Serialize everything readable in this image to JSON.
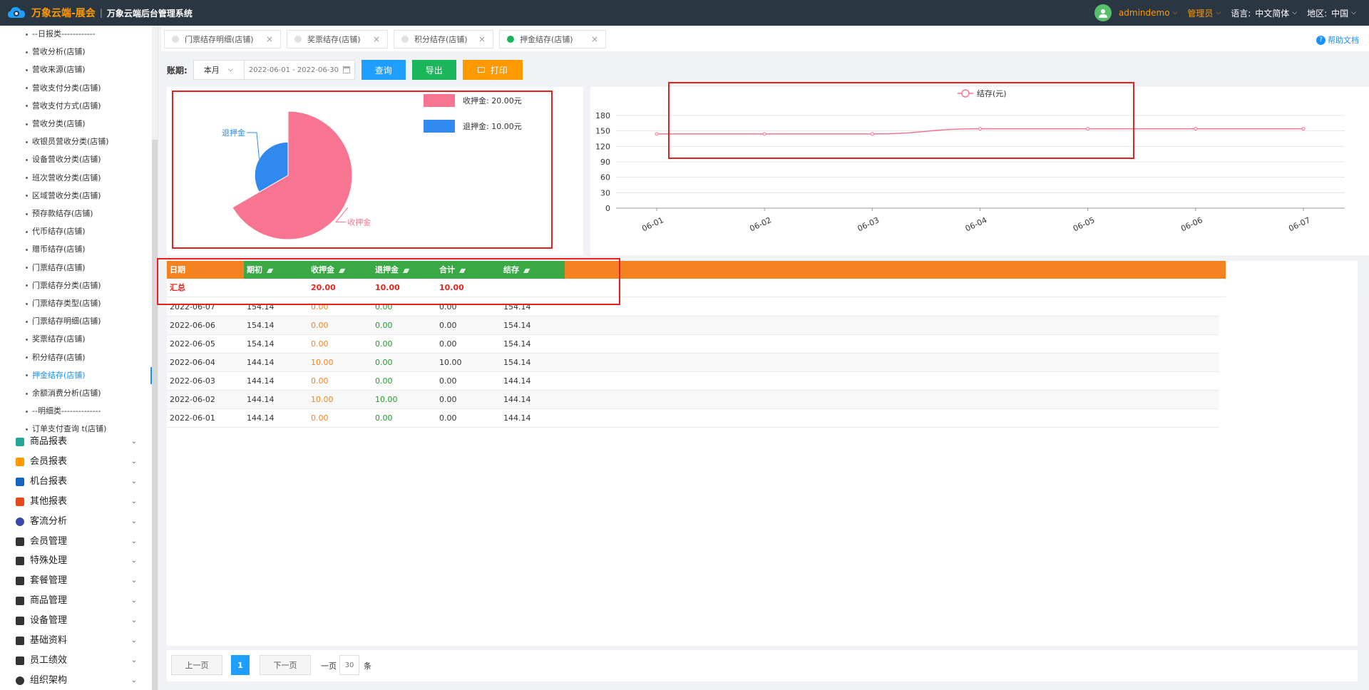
{
  "header": {
    "brand": "万象云端-展会",
    "separator": "|",
    "system_name": "万象云端后台管理系统",
    "user": "admindemo",
    "role": "管理员",
    "language_label": "语言:",
    "language_value": "中文简体",
    "region_label": "地区:",
    "region_value": "中国"
  },
  "sidebar": {
    "sub_items": [
      {
        "label": "--日报类------------"
      },
      {
        "label": "营收分析(店铺)"
      },
      {
        "label": "营收来源(店铺)"
      },
      {
        "label": "营收支付分类(店铺)"
      },
      {
        "label": "营收支付方式(店铺)"
      },
      {
        "label": "营收分类(店铺)"
      },
      {
        "label": "收银员营收分类(店铺)"
      },
      {
        "label": "设备营收分类(店铺)"
      },
      {
        "label": "班次营收分类(店铺)"
      },
      {
        "label": "区域营收分类(店铺)"
      },
      {
        "label": "预存款结存(店铺)"
      },
      {
        "label": "代币结存(店铺)"
      },
      {
        "label": "赠币结存(店铺)"
      },
      {
        "label": "门票结存(店铺)"
      },
      {
        "label": "门票结存分类(店铺)"
      },
      {
        "label": "门票结存类型(店铺)"
      },
      {
        "label": "门票结存明细(店铺)"
      },
      {
        "label": "奖票结存(店铺)"
      },
      {
        "label": "积分结存(店铺)"
      },
      {
        "label": "押金结存(店铺)"
      },
      {
        "label": "余额消费分析(店铺)"
      },
      {
        "label": "--明细类--------------"
      },
      {
        "label": "订单支付查询 t(店铺)"
      }
    ],
    "active_index": 19,
    "groups": [
      {
        "label": "商品报表",
        "icon": "goods-report-icon",
        "color": "#26a69a"
      },
      {
        "label": "会员报表",
        "icon": "member-report-icon",
        "color": "#ff9900"
      },
      {
        "label": "机台报表",
        "icon": "machine-report-icon",
        "color": "#1565c0"
      },
      {
        "label": "其他报表",
        "icon": "layers-icon",
        "color": "#e64a19"
      },
      {
        "label": "客流分析",
        "icon": "target-icon",
        "color": "#3949ab"
      },
      {
        "label": "会员管理",
        "icon": "user-icon",
        "color": "#333333"
      },
      {
        "label": "特殊处理",
        "icon": "warning-icon",
        "color": "#333333"
      },
      {
        "label": "套餐管理",
        "icon": "edit-icon",
        "color": "#333333"
      },
      {
        "label": "商品管理",
        "icon": "swap-icon",
        "color": "#333333"
      },
      {
        "label": "设备管理",
        "icon": "tool-icon",
        "color": "#333333"
      },
      {
        "label": "基础资料",
        "icon": "file-icon",
        "color": "#333333"
      },
      {
        "label": "员工绩效",
        "icon": "gear-icon",
        "color": "#333333"
      },
      {
        "label": "组织架构",
        "icon": "circle-dot-icon",
        "color": "#333333"
      }
    ]
  },
  "tabs": [
    {
      "label": "门票结存明细(店铺)",
      "active": false
    },
    {
      "label": "奖票结存(店铺)",
      "active": false
    },
    {
      "label": "积分结存(店铺)",
      "active": false
    },
    {
      "label": "押金结存(店铺)",
      "active": true
    }
  ],
  "help_label": "帮助文档",
  "filters": {
    "period_label": "账期:",
    "period_value": "本月",
    "date_range": "2022-06-01 - 2022-06-30",
    "query_label": "查询",
    "export_label": "导出",
    "print_label": "打印"
  },
  "colors": {
    "pink": "#f87592",
    "blue": "#2f89ef",
    "orange_header": "#f58220",
    "green_header": "#39a845",
    "highlight_frame": "#e8201c"
  },
  "chart_data": [
    {
      "type": "pie",
      "slices": [
        {
          "name": "收押金",
          "value": 20.0,
          "color": "#f87592"
        },
        {
          "name": "退押金",
          "value": 10.0,
          "color": "#2f89ef"
        }
      ],
      "legend": [
        {
          "text": "收押金: 20.00元",
          "color": "#f87592"
        },
        {
          "text": "退押金: 10.00元",
          "color": "#2f89ef"
        }
      ],
      "legend_position": "top-right"
    },
    {
      "type": "line",
      "series": [
        {
          "name": "结存(元)",
          "color": "#f87592",
          "values": [
            144.14,
            144.14,
            144.14,
            154.14,
            154.14,
            154.14,
            154.14
          ]
        }
      ],
      "categories": [
        "06-01",
        "06-02",
        "06-03",
        "06-04",
        "06-05",
        "06-06",
        "06-07"
      ],
      "ylim": [
        0,
        180
      ],
      "yticks": [
        0,
        30,
        60,
        90,
        120,
        150,
        180
      ],
      "grid": true,
      "legend_position": "top-center"
    }
  ],
  "table": {
    "columns": [
      {
        "label": "日期",
        "sortable": false
      },
      {
        "label": "期初",
        "sortable": true
      },
      {
        "label": "收押金",
        "sortable": true
      },
      {
        "label": "退押金",
        "sortable": true
      },
      {
        "label": "合计",
        "sortable": true
      },
      {
        "label": "结存",
        "sortable": true
      }
    ],
    "summary": [
      "汇总",
      "",
      "20.00",
      "10.00",
      "10.00",
      ""
    ],
    "rows": [
      [
        "2022-06-07",
        "154.14",
        "0.00",
        "0.00",
        "0.00",
        "154.14"
      ],
      [
        "2022-06-06",
        "154.14",
        "0.00",
        "0.00",
        "0.00",
        "154.14"
      ],
      [
        "2022-06-05",
        "154.14",
        "0.00",
        "0.00",
        "0.00",
        "154.14"
      ],
      [
        "2022-06-04",
        "144.14",
        "10.00",
        "0.00",
        "10.00",
        "154.14"
      ],
      [
        "2022-06-03",
        "144.14",
        "0.00",
        "0.00",
        "0.00",
        "144.14"
      ],
      [
        "2022-06-02",
        "144.14",
        "10.00",
        "10.00",
        "0.00",
        "144.14"
      ],
      [
        "2022-06-01",
        "144.14",
        "0.00",
        "0.00",
        "0.00",
        "144.14"
      ]
    ]
  },
  "pagination": {
    "prev_label": "上一页",
    "current_page": "1",
    "next_label": "下一页",
    "per_page_label": "一页",
    "per_page_value": "30",
    "unit_label": "条"
  }
}
